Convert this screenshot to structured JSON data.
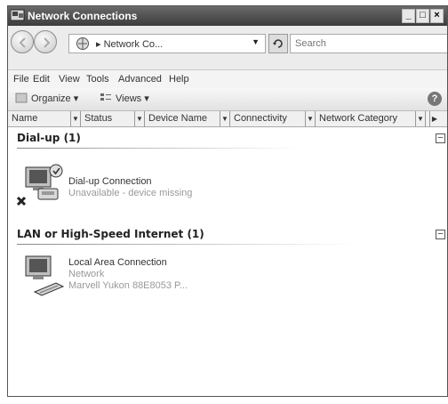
{
  "window": {
    "title": "Network Connections",
    "min_label": "_",
    "max_label": "□",
    "close_label": "×"
  },
  "address": {
    "breadcrumb": "▸ Network Co...",
    "search_placeholder": "Search"
  },
  "menu": [
    "File",
    "Edit",
    "View",
    "Tools",
    "Advanced",
    "Help"
  ],
  "toolbar": {
    "organize_label": "Organize ▾",
    "views_label": "Views ▾",
    "help_label": "?"
  },
  "columns": [
    "Name",
    "Status",
    "Device Name",
    "Connectivity",
    "Network Category"
  ],
  "groups": [
    {
      "header": "Dial-up (1)",
      "items": [
        {
          "name": "Dial-up Connection",
          "line2": "Unavailable - device missing",
          "line3": "",
          "icon": "dialup-modem-icon"
        }
      ]
    },
    {
      "header": "LAN or High-Speed Internet (1)",
      "items": [
        {
          "name": "Local Area Connection",
          "line2": "Network",
          "line3": "Marvell Yukon 88E8053 P...",
          "icon": "lan-connection-icon"
        }
      ]
    }
  ],
  "icons": {
    "back": "back-arrow-icon",
    "forward": "forward-arrow-icon",
    "refresh": "refresh-icon",
    "help": "help-icon"
  },
  "colors": {
    "titlebar": "#4a4a4a",
    "toolbar": "#e8e8e8"
  }
}
